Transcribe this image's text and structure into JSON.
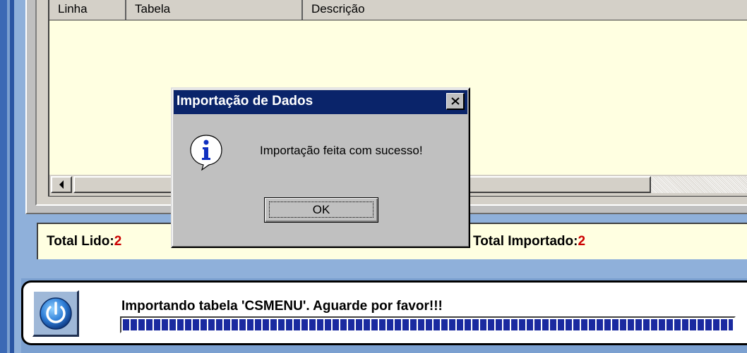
{
  "grid": {
    "columns": [
      "Linha",
      "Tabela",
      "Descrição"
    ]
  },
  "totals": {
    "lido_label": "Total Lido:",
    "lido_value": "2",
    "importado_label": "Total Importado:",
    "importado_value": "2"
  },
  "status": {
    "message": "Importando tabela 'CSMENU'. Aguarde por favor!!!",
    "progress": 1.0,
    "power_icon": "power-icon"
  },
  "dialog": {
    "title": "Importação de Dados",
    "message": "Importação feita com sucesso!",
    "ok_label": "OK",
    "icon": "info-icon",
    "close_icon": "close-icon"
  },
  "colors": {
    "accent_blue": "#0a246a",
    "total_value_red": "#cc0000",
    "grid_background": "#ffffe1",
    "progress_blue": "#1a2aa0"
  }
}
